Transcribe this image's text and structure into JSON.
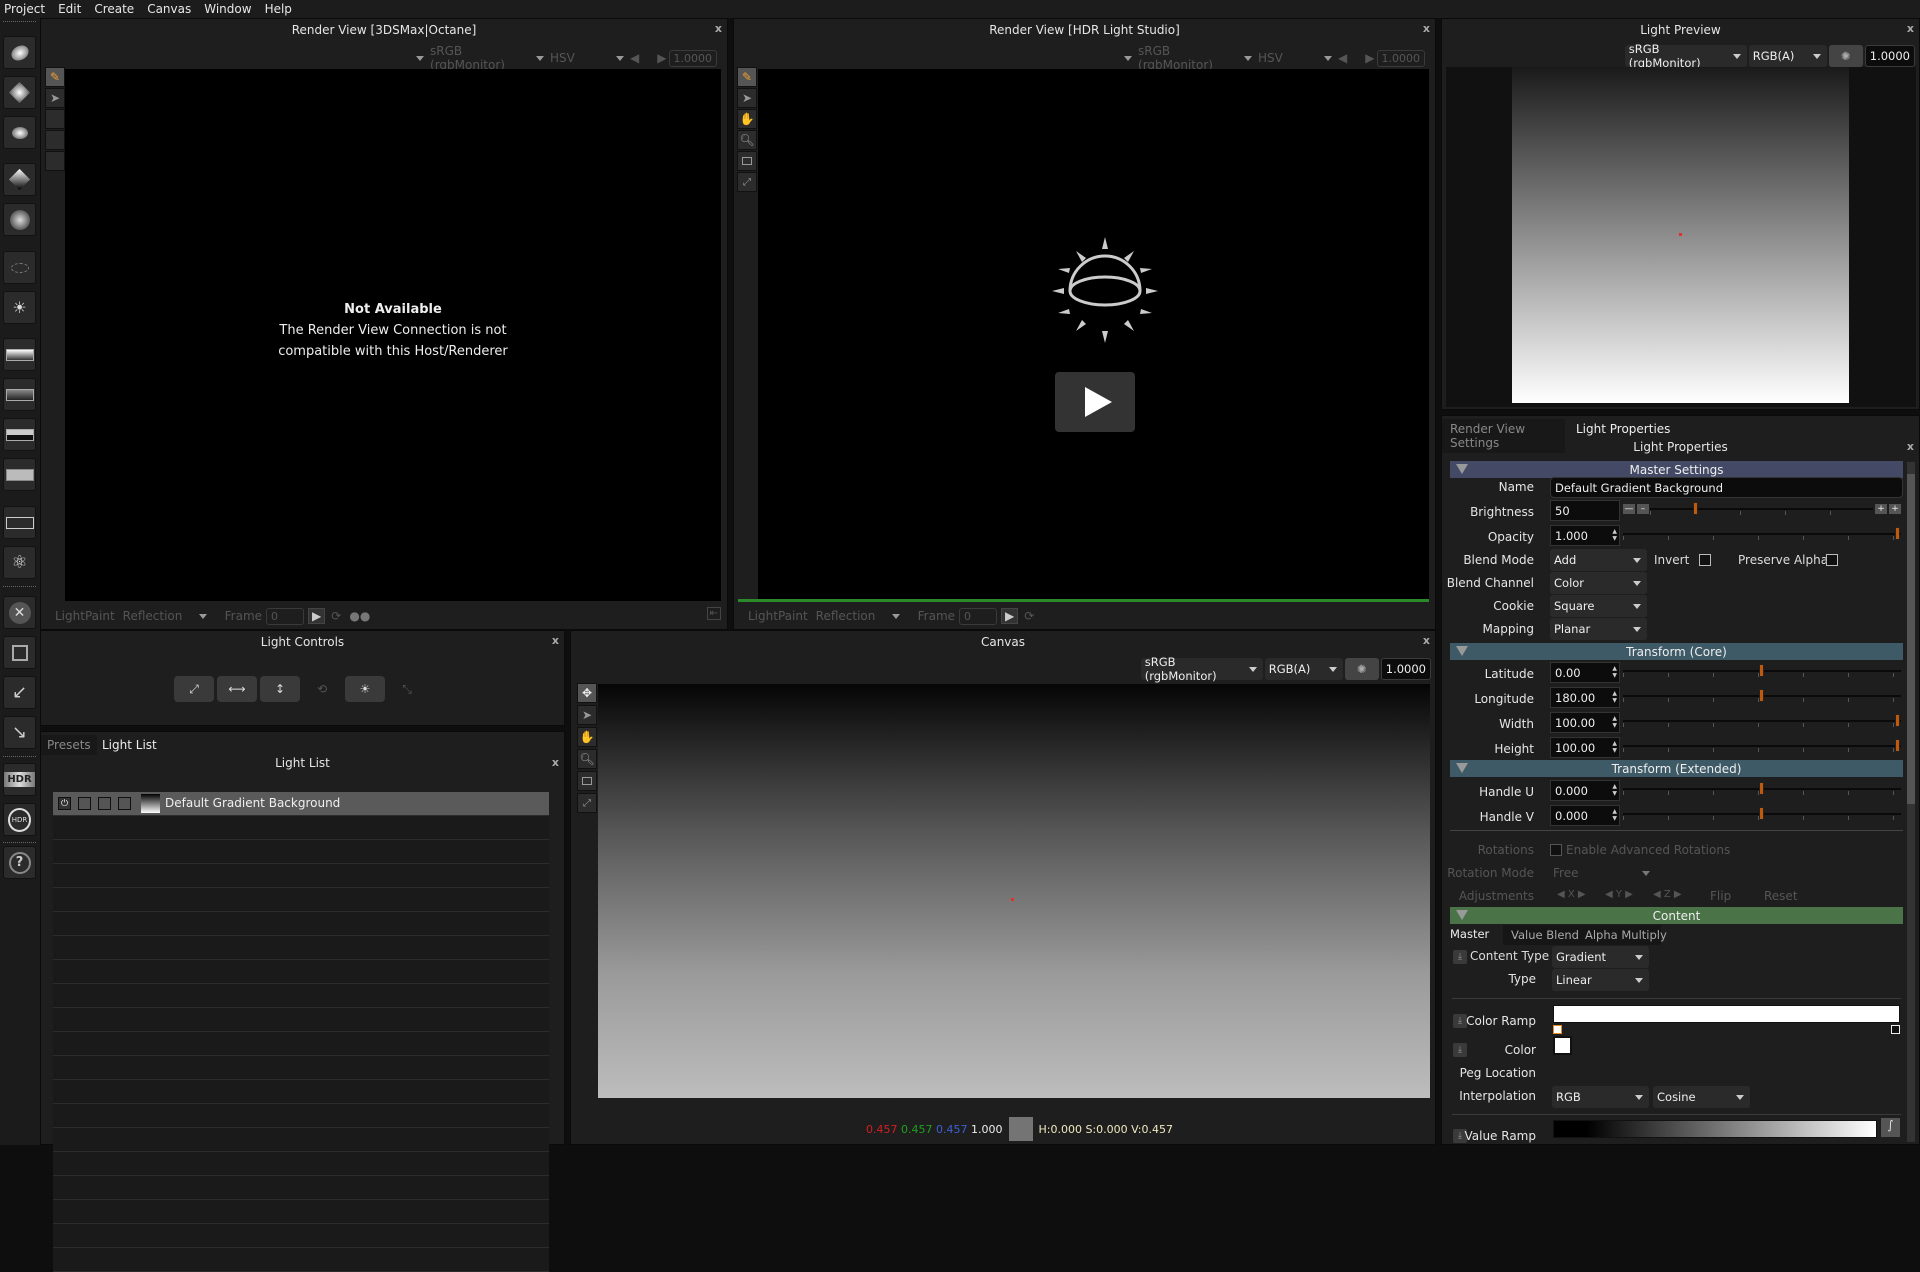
{
  "menu": [
    "Project",
    "Edit",
    "Create",
    "Canvas",
    "Window",
    "Help"
  ],
  "left_toolbar": {
    "tools": [
      "add-area-light",
      "add-rect-light",
      "add-spot-light",
      "add-gradient-light",
      "add-cookie-light",
      "add-lightpaint",
      "add-sun-light",
      "preset-gradient",
      "preset-hdri",
      "preset-sky",
      "preset-flat",
      "group-lights",
      "atom-light",
      "delete-light",
      "duplicate-light",
      "undo",
      "redo",
      "hdr-export",
      "hdr-refresh",
      "help"
    ],
    "hdr_label": "HDR"
  },
  "render_view_3ds": {
    "title": "Render View [3DSMax|Octane]",
    "colorspace": "sRGB (rgbMonitor)",
    "channel": "HSV",
    "exposure": "1.0000",
    "message_title": "Not Available",
    "message_line1": "The Render View Connection is not",
    "message_line2": "compatible with this Host/Renderer",
    "bottom": {
      "mode": "LightPaint",
      "paint_target": "Reflection",
      "frame_label": "Frame",
      "frame_value": "0"
    }
  },
  "render_view_hdr": {
    "title": "Render View [HDR Light Studio]",
    "colorspace": "sRGB (rgbMonitor)",
    "channel": "HSV",
    "exposure": "1.0000",
    "bottom": {
      "mode": "LightPaint",
      "paint_target": "Reflection",
      "frame_label": "Frame",
      "frame_value": "0"
    }
  },
  "light_preview": {
    "title": "Light Preview",
    "colorspace": "sRGB (rgbMonitor)",
    "channel": "RGB(A)",
    "exposure": "1.0000"
  },
  "light_controls": {
    "title": "Light Controls"
  },
  "light_list_panel": {
    "tabs": [
      "Presets",
      "Light List"
    ],
    "active_tab": "Light List",
    "title": "Light List",
    "items": [
      {
        "name": "Default Gradient Background",
        "selected": true
      }
    ]
  },
  "canvas": {
    "title": "Canvas",
    "colorspace": "sRGB (rgbMonitor)",
    "channel": "RGB(A)",
    "exposure": "1.0000",
    "status": {
      "r": "0.457",
      "g": "0.457",
      "b": "0.457",
      "a": "1.000",
      "hsv": "H:0.000 S:0.000 V:0.457",
      "swatch_color": "#747474"
    }
  },
  "properties": {
    "tabs": [
      "Render View Settings",
      "Light Properties"
    ],
    "active_tab": "Light Properties",
    "title": "Light Properties",
    "master": {
      "header": "Master Settings",
      "name_label": "Name",
      "name_value": "Default Gradient Background",
      "brightness_label": "Brightness",
      "brightness_value": "50",
      "brightness_fraction": 0.2,
      "opacity_label": "Opacity",
      "opacity_value": "1.000",
      "opacity_fraction": 1.0,
      "blend_mode_label": "Blend Mode",
      "blend_mode_value": "Add",
      "invert_label": "Invert",
      "invert_checked": false,
      "preserve_alpha_label": "Preserve Alpha",
      "preserve_alpha_checked": false,
      "blend_channel_label": "Blend Channel",
      "blend_channel_value": "Color",
      "cookie_label": "Cookie",
      "cookie_value": "Square",
      "mapping_label": "Mapping",
      "mapping_value": "Planar"
    },
    "transform_core": {
      "header": "Transform (Core)",
      "rows": [
        {
          "label": "Latitude",
          "value": "0.00",
          "fraction": 0.5
        },
        {
          "label": "Longitude",
          "value": "180.00",
          "fraction": 0.5
        },
        {
          "label": "Width",
          "value": "100.00",
          "fraction": 1.0
        },
        {
          "label": "Height",
          "value": "100.00",
          "fraction": 1.0
        }
      ]
    },
    "transform_extended": {
      "header": "Transform (Extended)",
      "rows": [
        {
          "label": "Handle U",
          "value": "0.000",
          "fraction": 0.5
        },
        {
          "label": "Handle V",
          "value": "0.000",
          "fraction": 0.5
        }
      ],
      "rotations_label": "Rotations",
      "enable_adv_rot": "Enable Advanced Rotations",
      "rotation_mode_label": "Rotation Mode",
      "rotation_mode_value": "Free",
      "adjustments_label": "Adjustments",
      "adj_x": "X",
      "adj_y": "Y",
      "adj_z": "Z",
      "flip": "Flip",
      "reset": "Reset"
    },
    "content": {
      "header": "Content",
      "tabs": [
        "Master",
        "Value Blend",
        "Alpha Multiply"
      ],
      "active_tab": "Master",
      "content_type_label": "Content Type",
      "content_type_value": "Gradient",
      "type_label": "Type",
      "type_value": "Linear",
      "color_ramp_label": "Color Ramp",
      "color_label": "Color",
      "color_value": "#ffffff",
      "peg_location_label": "Peg Location",
      "interpolation_label": "Interpolation",
      "interpolation_space": "RGB",
      "interpolation_curve": "Cosine",
      "value_ramp_label": "Value Ramp"
    }
  },
  "colors": {
    "accent_orange": "#c05a0a",
    "master_header": "#444a66",
    "transform_header": "#3e5a66",
    "content_header": "#4a7448",
    "progress_green": "#2a8a2a"
  }
}
